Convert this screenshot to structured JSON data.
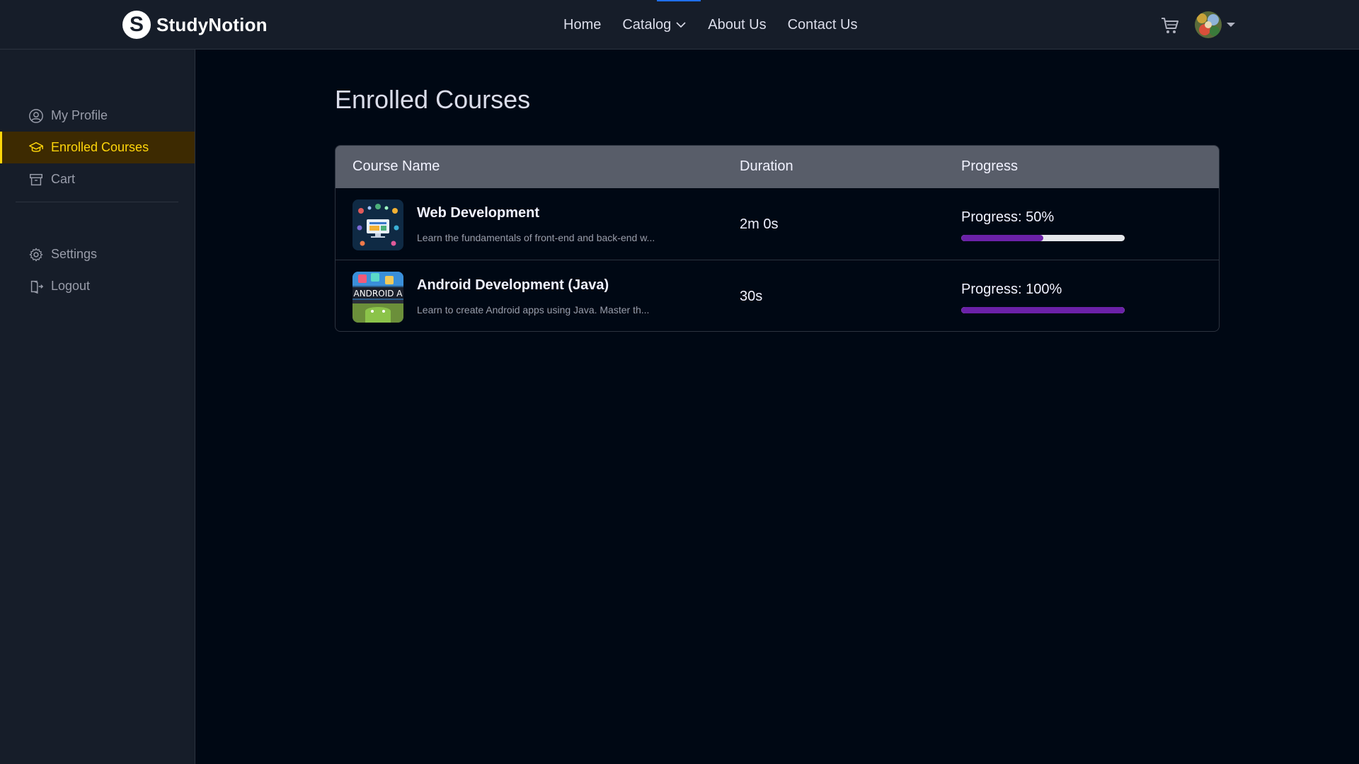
{
  "brand": {
    "name": "StudyNotion",
    "logo_letter": "S"
  },
  "nav": {
    "links": [
      {
        "label": "Home"
      },
      {
        "label": "Catalog"
      },
      {
        "label": "About Us"
      },
      {
        "label": "Contact Us"
      }
    ]
  },
  "header": {
    "cart_icon": "cart-icon",
    "avatar_icon": "avatar",
    "dropdown_icon": "caret-down-icon"
  },
  "sidebar": {
    "items": [
      {
        "label": "My Profile",
        "icon": "user-circle-icon"
      },
      {
        "label": "Enrolled Courses",
        "icon": "graduation-cap-icon",
        "active": true
      },
      {
        "label": "Cart",
        "icon": "archive-icon"
      }
    ],
    "bottom_items": [
      {
        "label": "Settings",
        "icon": "gear-icon"
      },
      {
        "label": "Logout",
        "icon": "logout-icon"
      }
    ]
  },
  "main": {
    "title": "Enrolled Courses",
    "table": {
      "headers": [
        "Course Name",
        "Duration",
        "Progress"
      ],
      "rows": [
        {
          "title": "Web Development",
          "description": "Learn the fundamentals of front-end and back-end w...",
          "duration": "2m 0s",
          "progress_label": "Progress: 50%",
          "progress": 0.5
        },
        {
          "title": "Android Development (Java)",
          "description": "Learn to create Android apps using Java. Master th...",
          "duration": "30s",
          "progress_label": "Progress: 100%",
          "progress": 1.0,
          "thumb_text": "ANDROID A"
        }
      ]
    }
  },
  "colors": {
    "accent_yellow": "#ffd60a",
    "progress_purple": "#6b21a8",
    "background": "#000814",
    "panel": "#161d29"
  }
}
